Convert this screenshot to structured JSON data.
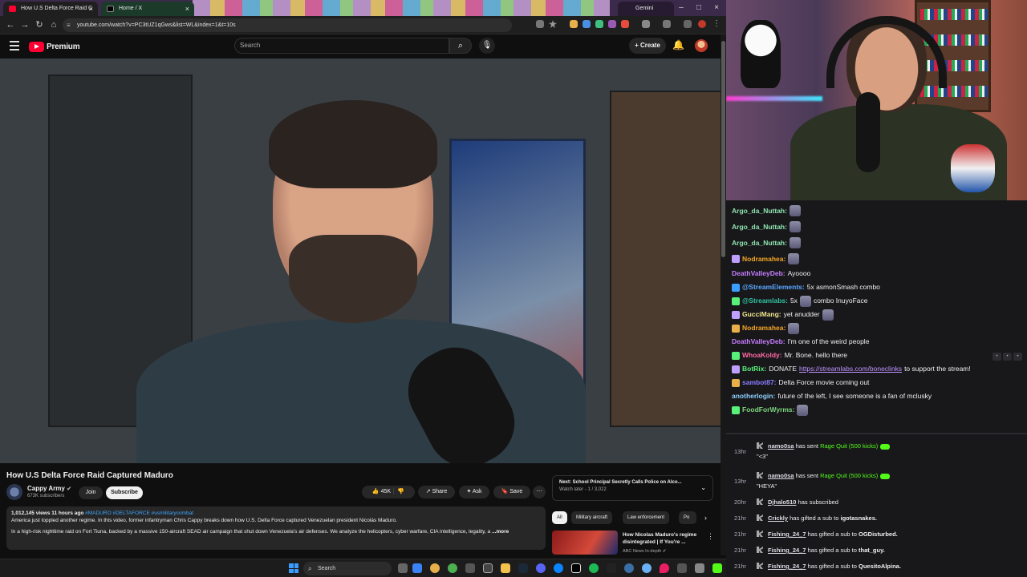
{
  "browser": {
    "tabs": [
      {
        "title": "How U.S Delta Force Raid C"
      },
      {
        "title": "Home / X"
      },
      {
        "title": "Gemini"
      }
    ],
    "url": "youtube.com/watch?v=PC3tUZ1qGws&list=WL&index=1&t=10s"
  },
  "youtube": {
    "logo_text": "Premium",
    "search_placeholder": "Search",
    "create_label": "Create",
    "video": {
      "title": "How U.S Delta Force Raid Captured Maduro",
      "channel": "Cappy Army",
      "subscribers": "673K subscribers",
      "join_label": "Join",
      "subscribe_label": "Subscribe",
      "likes": "45K",
      "share_label": "Share",
      "ask_label": "Ask",
      "save_label": "Save",
      "views_line": "1,012,145 views  11 hours ago",
      "tags": "#MADURO #DELTAFORCE #usmilitarycombat",
      "desc_line1": "America just toppled another regime. In this video, former infantryman Chris Cappy breaks down how U.S. Delta Force captured Venezuelan president Nicolás Maduro.",
      "desc_line2": "In a high-risk nighttime raid on Fort Tiuna, backed by a massive 150-aircraft SEAD air campaign that shut down Venezuela's air defenses. We analyze the helicopters, cyber warfare, CIA intelligence, legality, a",
      "more_label": "...more"
    },
    "up_next": {
      "title": "Next: School Principal Secretly Calls Police on Alco...",
      "sub": "Watch later - 1 / 3,022"
    },
    "chips": [
      "All",
      "Military aircraft",
      "Law enforcement",
      "Po"
    ],
    "suggested": {
      "title": "How Nicolas Maduro's regime disintegrated | If You're ...",
      "channel": "ABC News In-depth"
    }
  },
  "chat": [
    {
      "user": "Argo_da_Nuttah:",
      "color": "#8fe3b0",
      "text": "",
      "emote": true
    },
    {
      "user": "Argo_da_Nuttah:",
      "color": "#8fe3b0",
      "text": "",
      "emote": true
    },
    {
      "user": "Argo_da_Nuttah:",
      "color": "#8fe3b0",
      "text": "",
      "emote": true
    },
    {
      "user": "Nodramahea:",
      "color": "#f5a623",
      "text": "",
      "emote": true
    },
    {
      "user": "DeathValleyDeb:",
      "color": "#c77dff",
      "text": "Ayoooo"
    },
    {
      "user": "@StreamElements:",
      "color": "#5aa7ff",
      "text": "5x asmonSmash combo"
    },
    {
      "user": "@Streamlabs:",
      "color": "#31c3a2",
      "text": "5x",
      "text2": "combo InuyoFace"
    },
    {
      "user": "GucciMang:",
      "color": "#f0e68c",
      "text": "yet anudder"
    },
    {
      "user": "Nodramahea:",
      "color": "#f5a623",
      "text": "",
      "emote": true
    },
    {
      "user": "DeathValleyDeb:",
      "color": "#c77dff",
      "text": "I'm one of the weird people"
    },
    {
      "user": "WhoaKoldy:",
      "color": "#ff6aa0",
      "text": "Mr. Bone. hello there"
    },
    {
      "user": "BotRix:",
      "color": "#59f07a",
      "text": "DONATE",
      "link": "https://streamlabs.com/boneclinks",
      "text2": "to support the stream!"
    },
    {
      "user": "sambot87:",
      "color": "#8a7dff",
      "text": "Delta Force movie coming out"
    },
    {
      "user": "anotherlogin:",
      "color": "#8fd0ff",
      "text": "future of the left, I see someone is a fan of mclusky"
    },
    {
      "user": "FoodForWyrms:",
      "color": "#7cd67c",
      "text": "",
      "emote": true
    }
  ],
  "events": [
    {
      "time": "13hr",
      "user": "namo0sa",
      "action": "has sent",
      "gift": "Rage Quit (500 kicks)",
      "note": "\"<3\""
    },
    {
      "time": "13hr",
      "user": "namo0sa",
      "action": "has sent",
      "gift": "Rage Quit (500 kicks)",
      "note": "\"HEYA\""
    },
    {
      "time": "20hr",
      "user": "Djhalo510",
      "action": "has subscribed"
    },
    {
      "time": "21hr",
      "user": "Crickly",
      "action": "has gifted a sub to",
      "target": "igotasnakes."
    },
    {
      "time": "21hr",
      "user": "Fishing_24_7",
      "action": "has gifted a sub to",
      "target": "OGDisturbed."
    },
    {
      "time": "21hr",
      "user": "Fishing_24_7",
      "action": "has gifted a sub to",
      "target": "that_guy."
    },
    {
      "time": "21hr",
      "user": "Fishing_24_7",
      "action": "has gifted a sub to",
      "target": "QuesitoAlpina."
    }
  ],
  "taskbar": {
    "search_label": "Search"
  }
}
